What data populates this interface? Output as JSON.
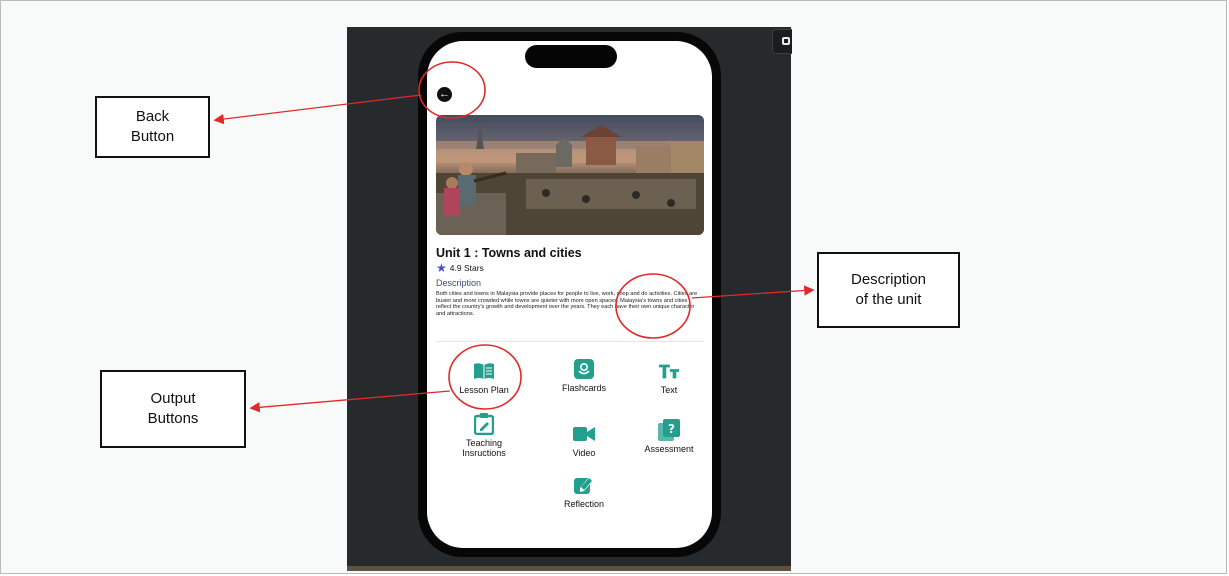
{
  "unit": {
    "title": "Unit 1 :  Towns and cities",
    "rating": "4.9 Stars",
    "description_label": "Description",
    "description": "Both cities and towns in Malaysia provide places for people to live, work, shop and do activities. Cities are busier and more crowded while towns are quieter with more open spaces. Malaysia's towns and cities reflect the country's growth and development over the years. They each have their own unique character and attractions."
  },
  "outputs": [
    {
      "label": "Lesson Plan",
      "icon": "book-icon"
    },
    {
      "label": "Flashcards",
      "icon": "flashcard-icon"
    },
    {
      "label": "Text",
      "icon": "text-size-icon"
    },
    {
      "label": "Teaching Insructions",
      "line1": "Teaching",
      "line2": "Insructions",
      "icon": "clipboard-edit-icon"
    },
    {
      "label": "Video",
      "icon": "video-camera-icon"
    },
    {
      "label": "Assessment",
      "icon": "question-cards-icon"
    },
    {
      "label": "Reflection",
      "icon": "edit-icon"
    }
  ],
  "annotations": {
    "back": {
      "line1": "Back",
      "line2": "Button"
    },
    "description": {
      "line1": "Description",
      "line2": "of the unit"
    },
    "output": {
      "line1": "Output",
      "line2": "Buttons"
    }
  },
  "colors": {
    "accent_teal": "#22a08d",
    "star": "#4a4bd8",
    "annotation_red": "#e02a2a",
    "dark_panel": "#262a2d"
  }
}
